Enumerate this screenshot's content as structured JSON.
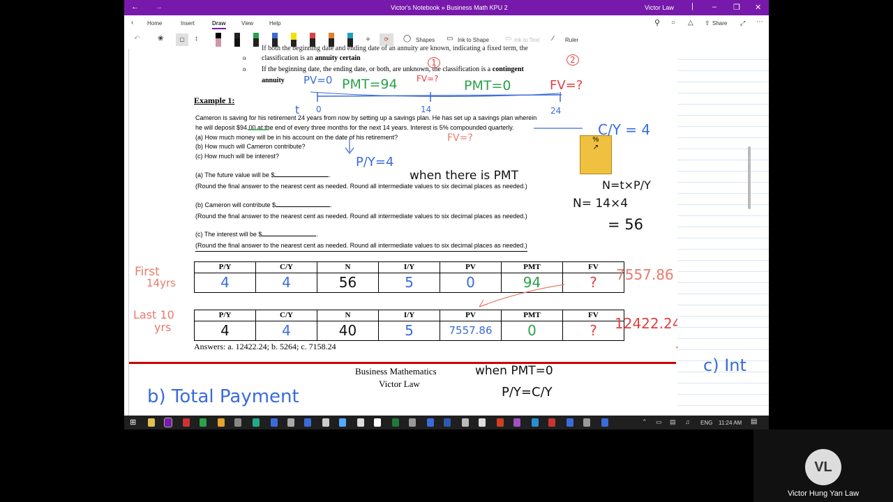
{
  "window": {
    "title": "Victor's Notebook » Business Math KPU 2",
    "user": "Victor Law"
  },
  "menu": {
    "home": "Home",
    "insert": "Insert",
    "draw": "Draw",
    "view": "View",
    "help": "Help",
    "share": "Share"
  },
  "drawbar": {
    "shapes": "Shapes",
    "ink_to_shape": "Ink to Shape",
    "ink_to_text": "Ink to Text",
    "ruler": "Ruler"
  },
  "doc": {
    "bullet1": "If both the beginning date and ending date of an annuity are known, indicating a fixed term, the classification is an annuity certain",
    "bullet1_a": "If both the beginning date and ending date of an annuity are known, indicating a fixed term, the",
    "bullet1_b": "classification is an ",
    "bullet1_bold": "annuity certain",
    "bullet2_a": "If the beginning date, the ending date, or both, are unknown, the classification is a ",
    "bullet2_bold1": "contingent",
    "bullet2_bold2": "annuity",
    "example_title": "Example 1:",
    "para1": "Cameron is saving for his retirement 24 years from now by setting up a savings plan. He has set up a savings plan wherein",
    "para2": "he will deposit $94.00 at the end of every three months for the next 14 years. Interest is 5% compounded quarterly.",
    "qa": "(a) How much money will be in his account on the date of his retirement?",
    "qb": "(b) How much will Cameron contribute?",
    "qc": "(c) How much will be interest?",
    "fa": "(a) The future value will be $",
    "fb": "(b) Cameron will contribute $",
    "fc": "(c) The interest will be $",
    "round": "(Round the final answer to the nearest cent as needed. Round all intermediate values to six decimal places as needed.)",
    "answers": "Answers: a. 12422.24; b. 5264; c. 7158.24",
    "footer1": "Business Mathematics",
    "footer2": "Victor Law"
  },
  "table": {
    "headers": [
      "P/Y",
      "C/Y",
      "N",
      "I/Y",
      "PV",
      "PMT",
      "FV"
    ],
    "row1": [
      "4",
      "4",
      "56",
      "5",
      "0",
      "94",
      "?"
    ],
    "row2": [
      "4",
      "4",
      "40",
      "5",
      "7557.86",
      "0",
      "?"
    ]
  },
  "ink": {
    "pv0": "PV=0",
    "pmt94": "PMT=94",
    "fvq1": "FV=?",
    "pmt0": "PMT=0",
    "fvq2": "FV=?",
    "c1": "1",
    "c2": "2",
    "t": "t",
    "t0": "0",
    "t14": "14",
    "t24": "24",
    "cy4": "C/Y = 4",
    "fvq3": "FV=?",
    "py4": "P/Y=4",
    "when_pmt": "when there is PMT",
    "n_formula": "N=t×P/Y",
    "n_calc": "N= 14×4",
    "n_res": "= 56",
    "first": "First",
    "first2": "14yrs",
    "last": "Last 10",
    "last2": "yrs",
    "fv1": "7557.86",
    "fv2": "12422.24",
    "when_pmt0": "when PMT=0",
    "py_cy": "P/Y=C/Y",
    "total_payment": "b) Total Payment",
    "c_int": "c) Int"
  },
  "taskbar": {
    "lang": "ENG",
    "time": "11:24 AM"
  },
  "participant": {
    "initials": "VL",
    "name": "Victor Hung Yan Law"
  }
}
